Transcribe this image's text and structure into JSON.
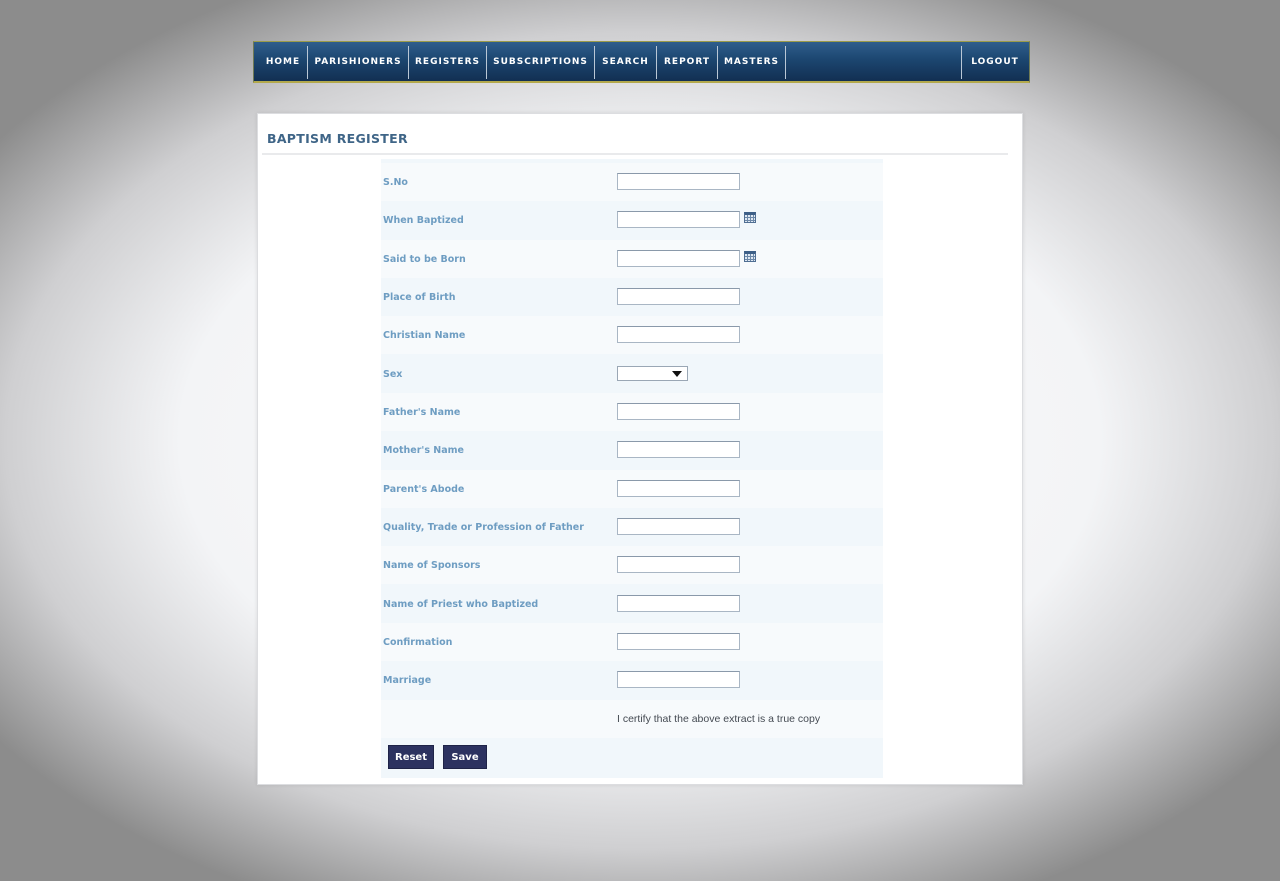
{
  "nav": {
    "items": [
      {
        "label": "HOME"
      },
      {
        "label": "PARISHIONERS"
      },
      {
        "label": "REGISTERS"
      },
      {
        "label": "SUBSCRIPTIONS"
      },
      {
        "label": "SEARCH"
      },
      {
        "label": "REPORT"
      },
      {
        "label": "MASTERS"
      }
    ],
    "logout": "LOGOUT"
  },
  "page": {
    "title": "BAPTISM REGISTER"
  },
  "form": {
    "fields": [
      {
        "label": "S.No",
        "type": "text",
        "value": ""
      },
      {
        "label": "When Baptized",
        "type": "date",
        "value": ""
      },
      {
        "label": "Said to be Born",
        "type": "date",
        "value": ""
      },
      {
        "label": "Place of Birth",
        "type": "text",
        "value": ""
      },
      {
        "label": "Christian Name",
        "type": "text",
        "value": ""
      },
      {
        "label": "Sex",
        "type": "select",
        "value": ""
      },
      {
        "label": "Father's Name",
        "type": "text",
        "value": ""
      },
      {
        "label": "Mother's Name",
        "type": "text",
        "value": ""
      },
      {
        "label": "Parent's Abode",
        "type": "text",
        "value": ""
      },
      {
        "label": "Quality, Trade or Profession of Father",
        "type": "text",
        "value": ""
      },
      {
        "label": "Name of Sponsors",
        "type": "text",
        "value": ""
      },
      {
        "label": "Name of Priest who Baptized",
        "type": "text",
        "value": ""
      },
      {
        "label": "Confirmation",
        "type": "text",
        "value": ""
      },
      {
        "label": "Marriage",
        "type": "text",
        "value": ""
      }
    ],
    "certify_text": "I certify that the above extract is a true copy",
    "buttons": {
      "reset": "Reset",
      "save": "Save"
    }
  },
  "icons": {
    "calendar": "calendar-icon",
    "dropdown": "chevron-down-icon"
  },
  "colors": {
    "nav_bg": "#1c4670",
    "nav_border": "#b3a94c",
    "title": "#3f6587",
    "label": "#6e9dc2",
    "button_bg": "#2c3260",
    "form_bg": "#f1f7fb"
  }
}
